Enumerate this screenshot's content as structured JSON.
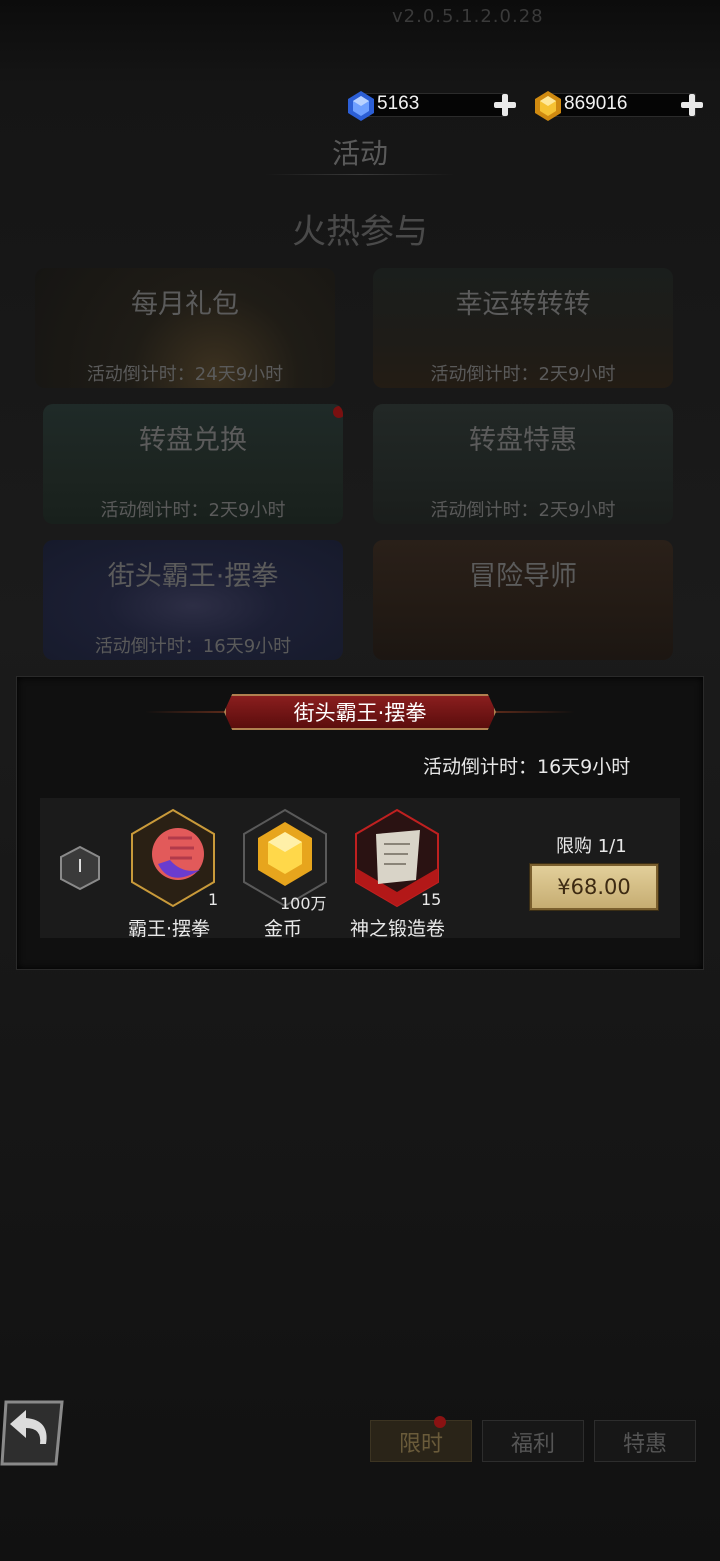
{
  "header": {
    "version_text": "v2.0.5.1.2.0.28",
    "currency": [
      {
        "icon": "blue-gem-icon",
        "amount": "5163",
        "accent": "#3d7bf0"
      },
      {
        "icon": "gold-gem-icon",
        "amount": "869016",
        "accent": "#f0b420"
      }
    ]
  },
  "page": {
    "title": "活动",
    "section_title": "火热参与"
  },
  "activities": [
    {
      "name": "每月礼包",
      "timer": "活动倒计时：24天9小时",
      "has_dot": false
    },
    {
      "name": "幸运转转转",
      "timer": "活动倒计时：2天9小时",
      "has_dot": false
    },
    {
      "name": "转盘兑换",
      "timer": "活动倒计时：2天9小时",
      "has_dot": true
    },
    {
      "name": "转盘特惠",
      "timer": "活动倒计时：2天9小时",
      "has_dot": false
    },
    {
      "name": "街头霸王·摆拳",
      "timer": "活动倒计时：16天9小时",
      "has_dot": false
    },
    {
      "name": "冒险导师",
      "timer": "",
      "has_dot": false
    }
  ],
  "detail": {
    "banner_title": "街头霸王·摆拳",
    "timer": "活动倒计时：16天9小时",
    "package": {
      "badge": "I",
      "items": [
        {
          "name": "霸王·摆拳",
          "count": "1",
          "icon": "fist-icon"
        },
        {
          "name": "金币",
          "count": "100万",
          "icon": "gold-coin-gem-icon"
        },
        {
          "name": "神之锻造卷",
          "count": "15",
          "icon": "scroll-icon"
        }
      ],
      "limit": "限购 1/1",
      "price": "¥68.00"
    }
  },
  "bottom_tabs": [
    {
      "label": "限时",
      "active": true,
      "has_dot": true
    },
    {
      "label": "福利",
      "active": false,
      "has_dot": false
    },
    {
      "label": "特惠",
      "active": false,
      "has_dot": false
    }
  ]
}
